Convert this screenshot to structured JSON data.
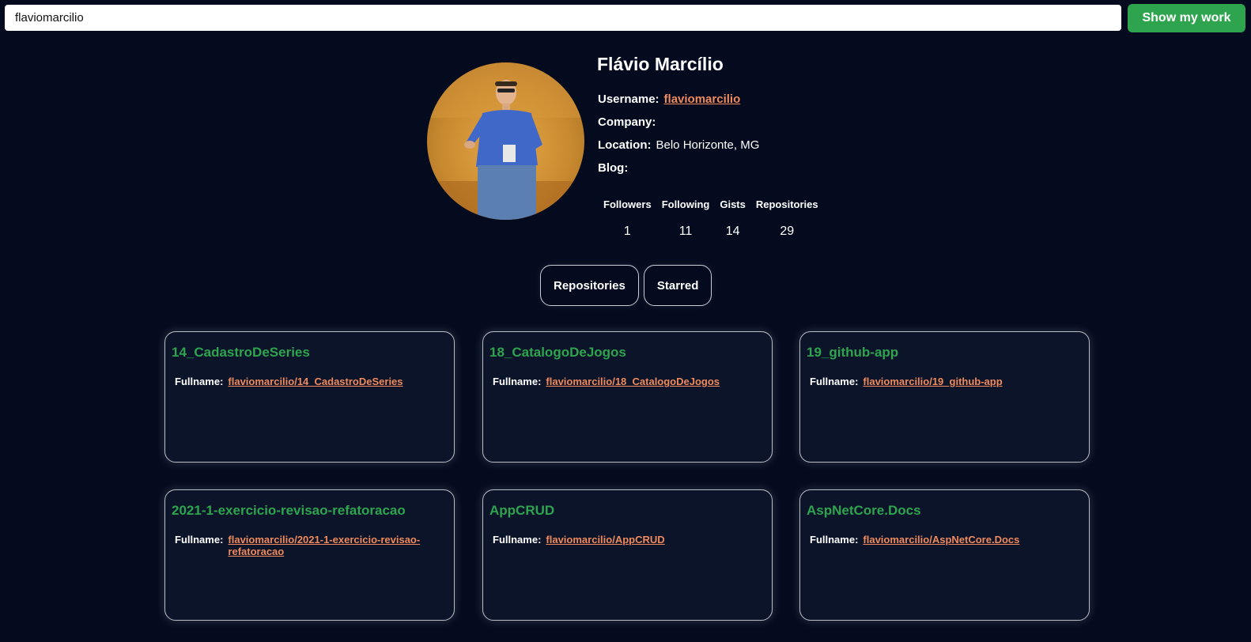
{
  "search": {
    "value": "flaviomarcilio",
    "button_label": "Show my work"
  },
  "profile": {
    "name": "Flávio Marcílio",
    "username_label": "Username:",
    "username": "flaviomarcilio",
    "company_label": "Company:",
    "company": "",
    "location_label": "Location:",
    "location": "Belo Horizonte, MG",
    "blog_label": "Blog:",
    "blog": ""
  },
  "stats": [
    {
      "label": "Followers",
      "value": "1"
    },
    {
      "label": "Following",
      "value": "11"
    },
    {
      "label": "Gists",
      "value": "14"
    },
    {
      "label": "Repositories",
      "value": "29"
    }
  ],
  "tabs": [
    {
      "label": "Repositories"
    },
    {
      "label": "Starred"
    }
  ],
  "repos": [
    {
      "name": "14_CadastroDeSeries",
      "fullname_label": "Fullname:",
      "fullname": "flaviomarcilio/14_CadastroDeSeries"
    },
    {
      "name": "18_CatalogoDeJogos",
      "fullname_label": "Fullname:",
      "fullname": "flaviomarcilio/18_CatalogoDeJogos"
    },
    {
      "name": "19_github-app",
      "fullname_label": "Fullname:",
      "fullname": "flaviomarcilio/19_github-app"
    },
    {
      "name": "2021-1-exercicio-revisao-refatoracao",
      "fullname_label": "Fullname:",
      "fullname": "flaviomarcilio/2021-1-exercicio-revisao-refatoracao"
    },
    {
      "name": "AppCRUD",
      "fullname_label": "Fullname:",
      "fullname": "flaviomarcilio/AppCRUD"
    },
    {
      "name": "AspNetCore.Docs",
      "fullname_label": "Fullname:",
      "fullname": "flaviomarcilio/AspNetCore.Docs"
    }
  ],
  "colors": {
    "background": "#040b1f",
    "accent_green": "#2ea44f",
    "link_orange": "#f08a5d",
    "card_bg": "#0b1429"
  }
}
